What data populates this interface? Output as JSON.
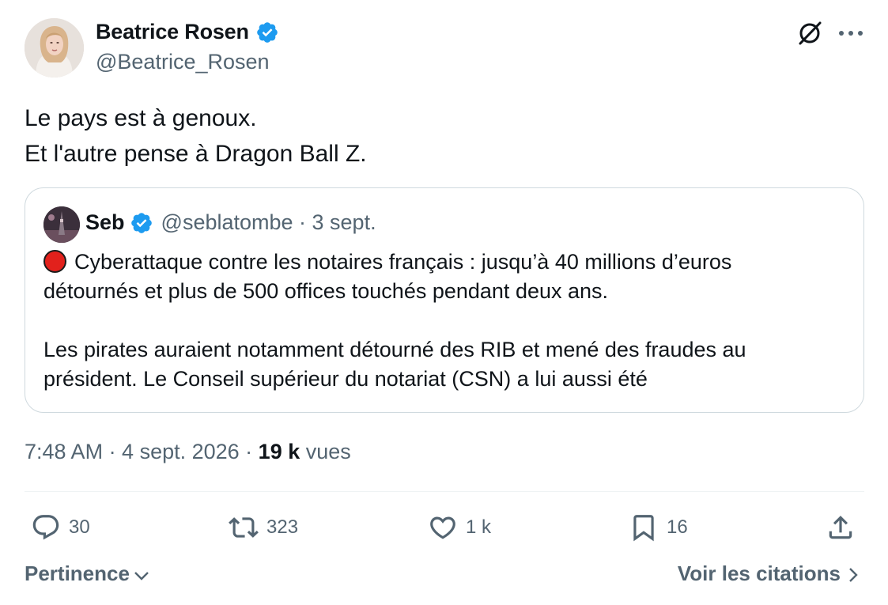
{
  "author": {
    "name": "Beatrice Rosen",
    "handle": "@Beatrice_Rosen",
    "verified": true
  },
  "tweet": {
    "lines": [
      "Le pays est à genoux.",
      "Et l'autre pense à Dragon Ball Z."
    ]
  },
  "quote": {
    "name": "Seb",
    "handle": "@seblatombe",
    "meta": "@seblatombe · 3 sept.",
    "verified": true,
    "emoji": "red-circle",
    "paragraph1": [
      "Cyberattaque contre les notaires français : jusqu’à 40 millions d’euros",
      "détournés et plus de 500 offices touchés pendant deux ans."
    ],
    "paragraph2": [
      "Les pirates auraient notamment détourné des RIB et mené des fraudes au",
      "président. Le Conseil supérieur du notariat (CSN) a lui aussi été"
    ]
  },
  "stamp": {
    "time_date": "7:48 AM · 4 sept. 2026 · ",
    "views_count": "19 k",
    "views_label": " vues"
  },
  "actions": {
    "replies": "30",
    "reposts": "323",
    "likes": "1 k",
    "bookmarks": "16"
  },
  "footer": {
    "sort_label": "Pertinence",
    "quotes_label": "Voir les citations"
  },
  "colors": {
    "verified_blue": "#1d9bf0",
    "muted_text": "#536471",
    "primary_text": "#0f1419",
    "border": "#cfd9de"
  }
}
